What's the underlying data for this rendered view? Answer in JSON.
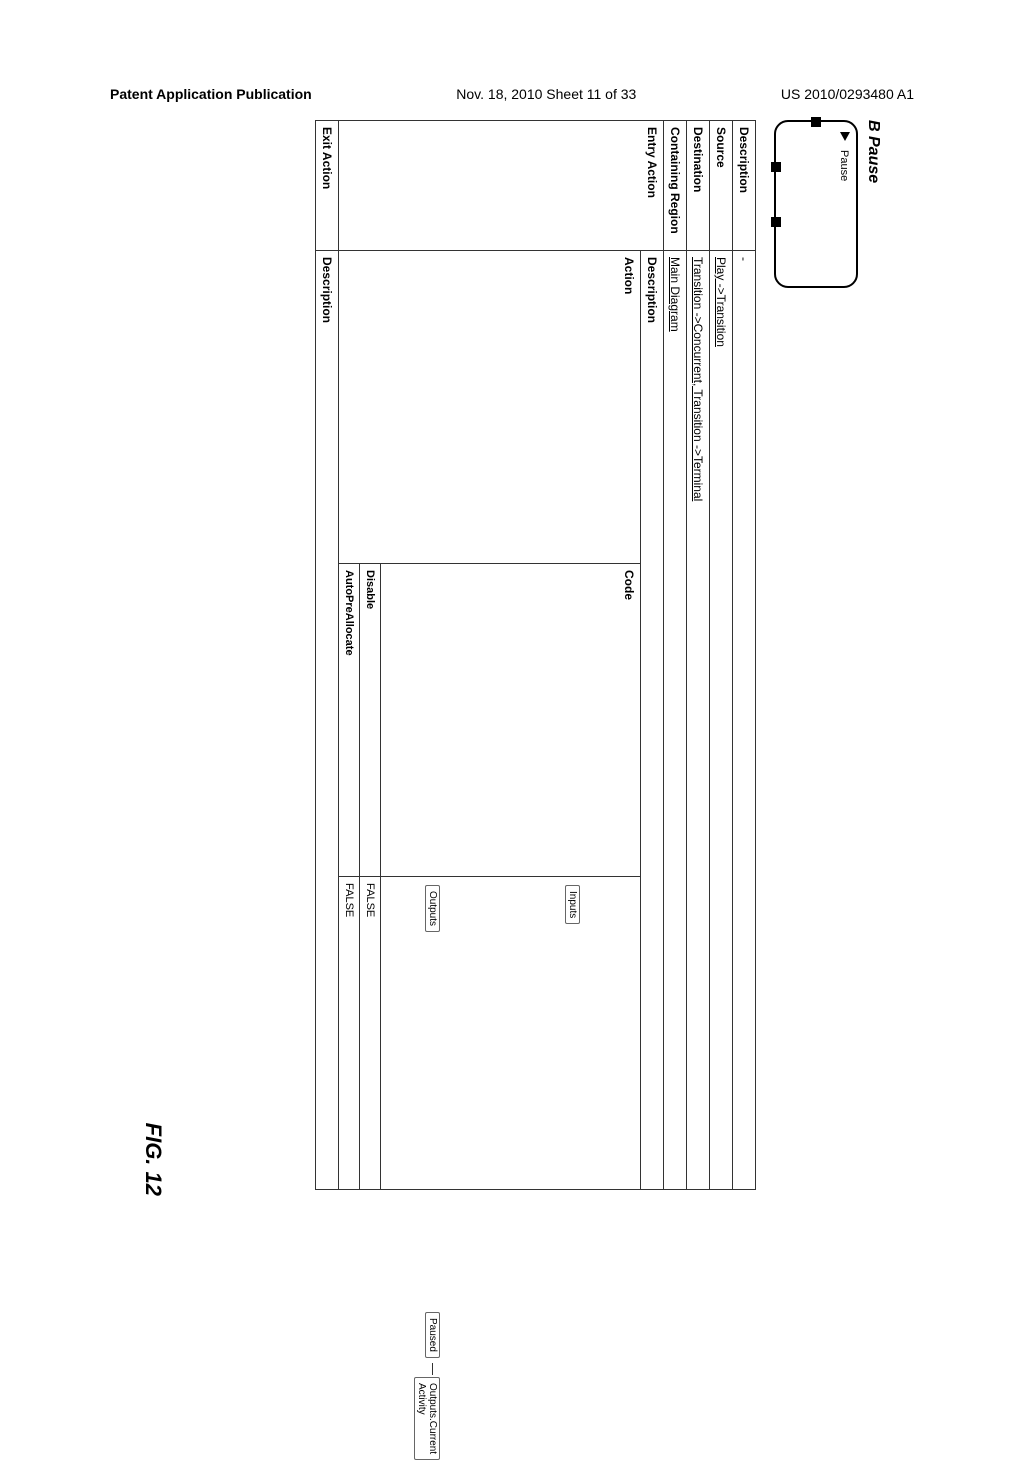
{
  "header": {
    "left": "Patent Application Publication",
    "center": "Nov. 18, 2010  Sheet 11 of 33",
    "right": "US 2010/0293480 A1"
  },
  "figure": {
    "title": "B Pause",
    "node_label": "Pause",
    "figlabel": "FIG. 12"
  },
  "props": {
    "description": {
      "label": "Description",
      "value": "-"
    },
    "source": {
      "label": "Source",
      "value": "Play ->Transition"
    },
    "destination": {
      "label": "Destination",
      "value": "Transition ->Concurrent,  Transition ->Terminal"
    },
    "region": {
      "label": "Containing Region",
      "value": "Main Diagram"
    },
    "entry_action": {
      "label": "Entry Action",
      "sub_description_label": "Description",
      "sub_action_label": "Action",
      "sub_code_label": "Code",
      "chip_inputs": "Inputs",
      "chip_outputs": "Outputs",
      "chip_paused": "Paused",
      "chip_currentact": "Outputs.Current Activity",
      "disable_label": "Disable",
      "disable_value": "FALSE",
      "autoprealloc_label": "AutoPreAllocate",
      "autoprealloc_value": "FALSE"
    },
    "exit_action": {
      "label": "Exit Action",
      "sub_description_label": "Description"
    }
  }
}
